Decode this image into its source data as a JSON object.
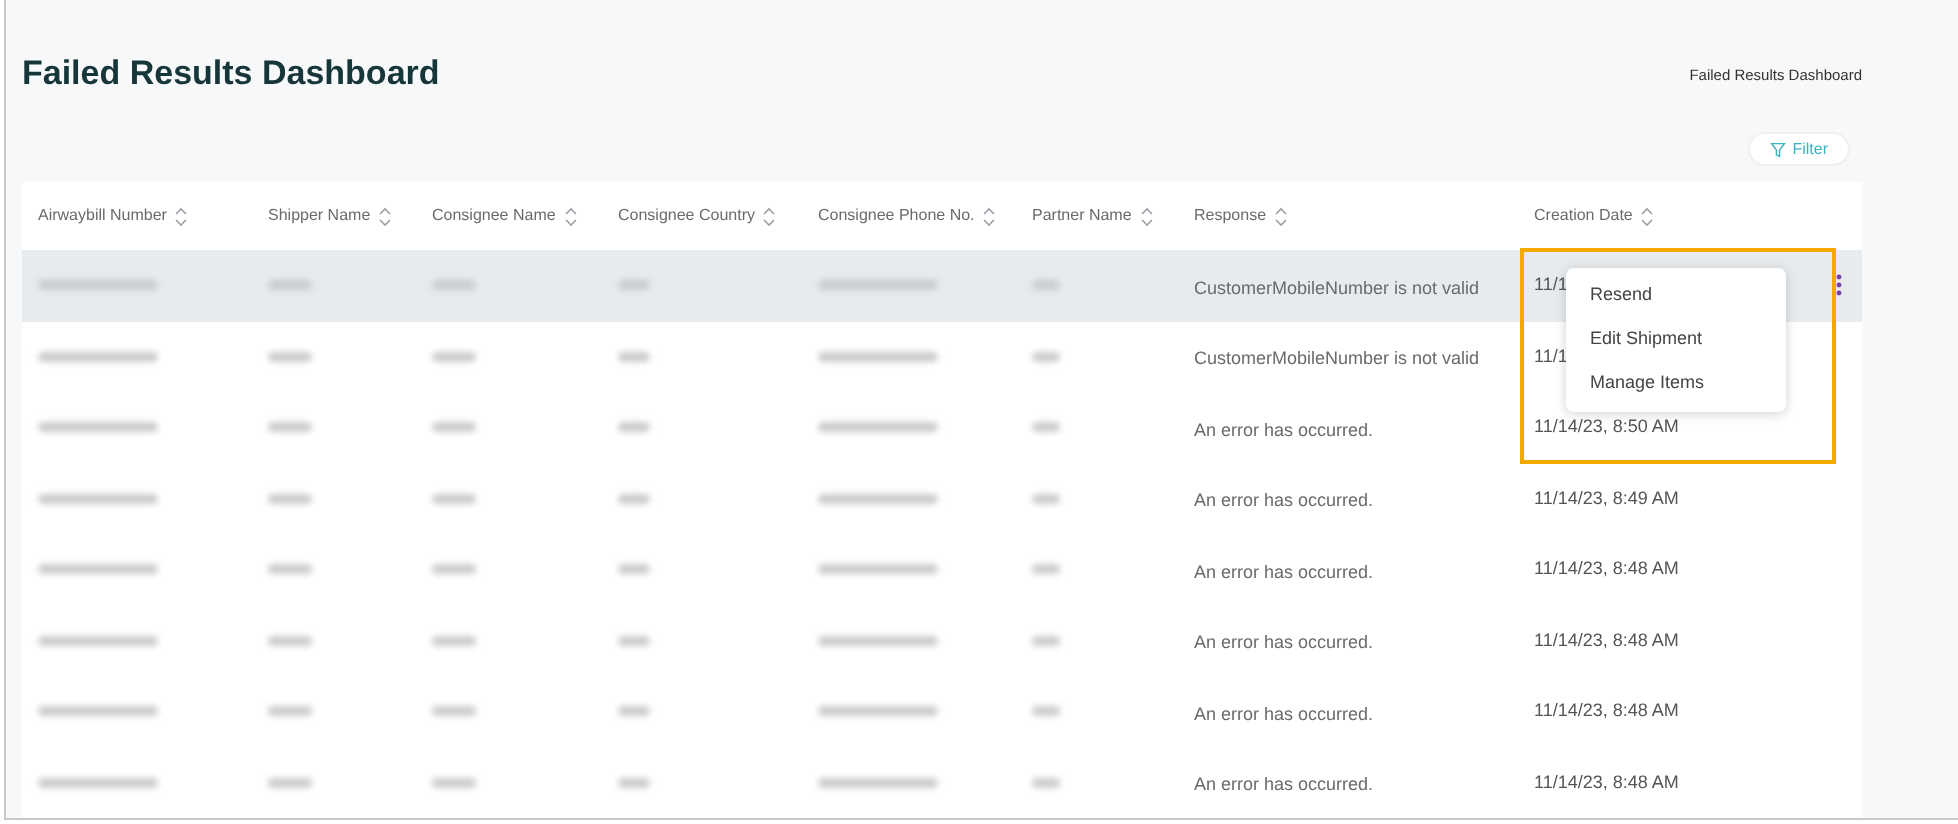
{
  "page_title": "Failed Results Dashboard",
  "breadcrumb": "Failed Results Dashboard",
  "filter_button": {
    "label": "Filter"
  },
  "table": {
    "columns": [
      "Airwaybill Number",
      "Shipper Name",
      "Consignee Name",
      "Consignee Country",
      "Consignee Phone No.",
      "Partner Name",
      "Response",
      "Creation Date"
    ],
    "rows": [
      {
        "selected": true,
        "response": "CustomerMobileNumber is not valid",
        "creation_date": "11/1",
        "actions_menu": true
      },
      {
        "selected": false,
        "response": "CustomerMobileNumber is not valid",
        "creation_date": "11/1",
        "actions_menu": false
      },
      {
        "selected": false,
        "response": "An error has occurred.",
        "creation_date": "11/14/23, 8:50 AM",
        "actions_menu": false
      },
      {
        "selected": false,
        "response": "An error has occurred.",
        "creation_date": "11/14/23, 8:49 AM",
        "actions_menu": false
      },
      {
        "selected": false,
        "response": "An error has occurred.",
        "creation_date": "11/14/23, 8:48 AM",
        "actions_menu": false
      },
      {
        "selected": false,
        "response": "An error has occurred.",
        "creation_date": "11/14/23, 8:48 AM",
        "actions_menu": false
      },
      {
        "selected": false,
        "response": "An error has occurred.",
        "creation_date": "11/14/23, 8:48 AM",
        "actions_menu": false
      },
      {
        "selected": false,
        "response": "An error has occurred.",
        "creation_date": "11/14/23, 8:48 AM",
        "actions_menu": false
      }
    ]
  },
  "context_menu": {
    "items": [
      "Resend",
      "Edit Shipment",
      "Manage Items"
    ]
  }
}
